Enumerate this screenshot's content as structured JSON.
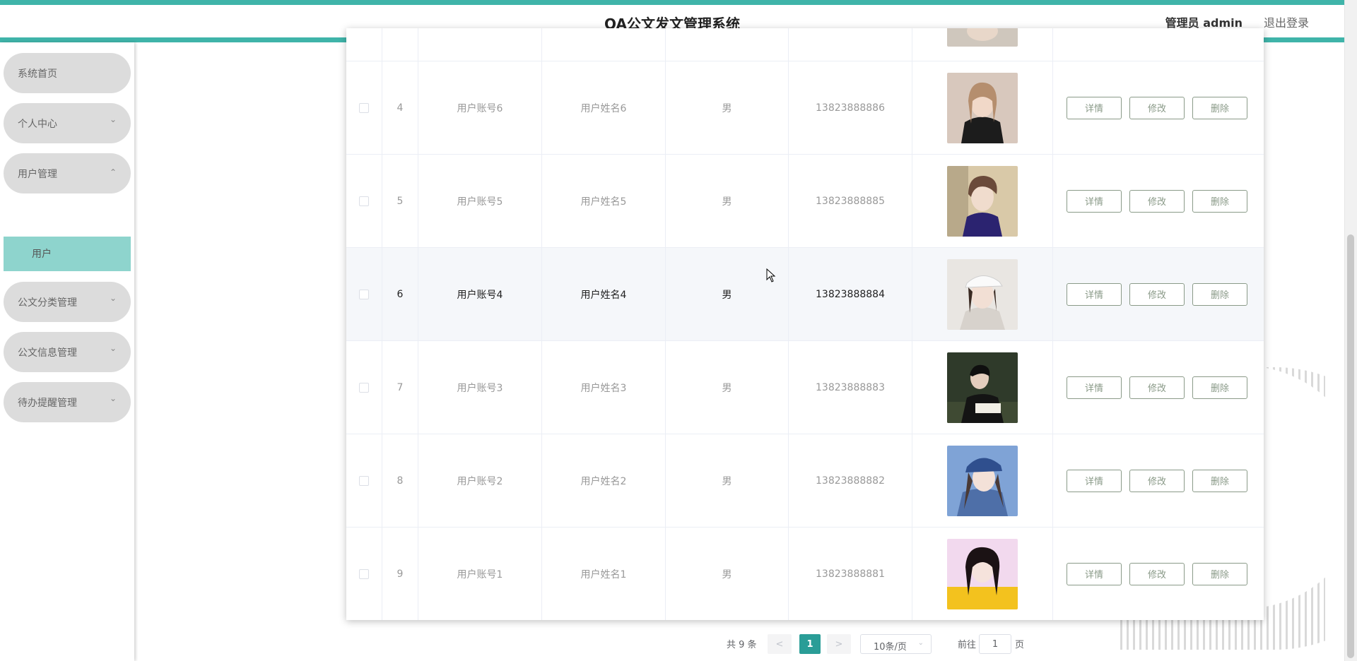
{
  "header": {
    "title": "OA公文发文管理系统",
    "user_label": "管理员 admin",
    "logout": "退出登录"
  },
  "sidebar": {
    "items": [
      {
        "label": "系统首页",
        "expandable": false
      },
      {
        "label": "个人中心",
        "expandable": true,
        "expanded": false
      },
      {
        "label": "用户管理",
        "expandable": true,
        "expanded": true
      },
      {
        "label": "公文分类管理",
        "expandable": true,
        "expanded": false
      },
      {
        "label": "公文信息管理",
        "expandable": true,
        "expanded": false
      },
      {
        "label": "待办提醒管理",
        "expandable": true,
        "expanded": false
      }
    ],
    "submenu": {
      "label": "用户",
      "active": true
    }
  },
  "table": {
    "rows": [
      {
        "index": "4",
        "account": "用户账号6",
        "name": "用户姓名6",
        "gender": "男",
        "phone": "13823888886",
        "highlighted": false
      },
      {
        "index": "5",
        "account": "用户账号5",
        "name": "用户姓名5",
        "gender": "男",
        "phone": "13823888885",
        "highlighted": false
      },
      {
        "index": "6",
        "account": "用户账号4",
        "name": "用户姓名4",
        "gender": "男",
        "phone": "13823888884",
        "highlighted": true
      },
      {
        "index": "7",
        "account": "用户账号3",
        "name": "用户姓名3",
        "gender": "男",
        "phone": "13823888883",
        "highlighted": false
      },
      {
        "index": "8",
        "account": "用户账号2",
        "name": "用户姓名2",
        "gender": "男",
        "phone": "13823888882",
        "highlighted": false
      },
      {
        "index": "9",
        "account": "用户账号1",
        "name": "用户姓名1",
        "gender": "男",
        "phone": "13823888881",
        "highlighted": false
      }
    ],
    "actions": {
      "detail": "详情",
      "edit": "修改",
      "delete": "删除"
    }
  },
  "pagination": {
    "total": "共 9 条",
    "prev": "<",
    "current": "1",
    "next": ">",
    "page_size": "10条/页",
    "goto_label": "前往",
    "goto_value": "1",
    "page_unit": "页"
  },
  "colors": {
    "accent": "#3fb4a9",
    "active_submenu": "#8ed4cd",
    "menu_bg": "#dcdcdc",
    "page_active": "#2a9d97",
    "button_border": "#8a9a88"
  }
}
